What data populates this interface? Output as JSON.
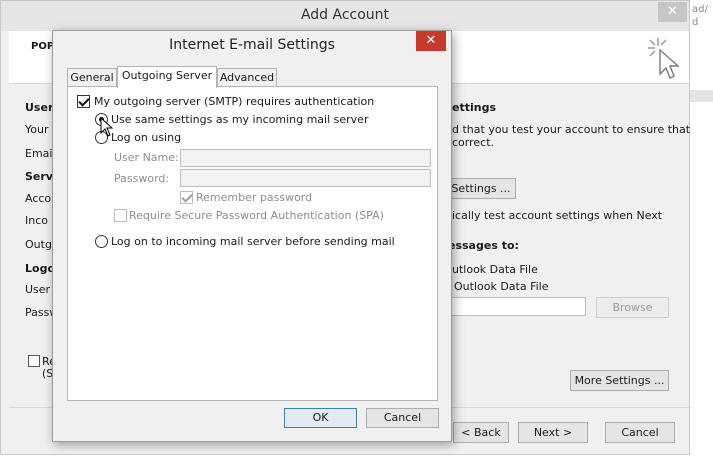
{
  "background": {
    "fragments": [
      "ad/",
      "d"
    ]
  },
  "add_account": {
    "title": "Add Account",
    "header_label": "POP",
    "labels": {
      "user_info_heading": "User",
      "your_name": "Your",
      "email": "Email",
      "server_heading": "Serve",
      "account_type": "Acco",
      "incoming": "Inco",
      "outgoing": "Outg",
      "logon_heading": "Logo",
      "user_name": "User",
      "password": "Passw",
      "remember": "Re",
      "remember_spa": "(S",
      "test_heading": "ettings",
      "test_desc_1": "d that you test your account to ensure that",
      "test_desc_2": "correct.",
      "auto_test_1": "ically test account settings when Next",
      "deliver_heading": "essages to:",
      "new_data_file": "utlook Data File",
      "existing_data_file": "Outlook Data File"
    },
    "buttons": {
      "test_settings": "Settings ...",
      "browse": "Browse",
      "more_settings": "More Settings ...",
      "back": "< Back",
      "next": "Next >",
      "cancel": "Cancel"
    }
  },
  "dialog": {
    "title": "Internet E-mail Settings",
    "tabs": [
      {
        "label": "General",
        "active": false
      },
      {
        "label": "Outgoing Server",
        "active": true
      },
      {
        "label": "Advanced",
        "active": false
      }
    ],
    "smtp_auth_label": "My outgoing server (SMTP) requires authentication",
    "smtp_auth_checked": true,
    "use_same_label": "Use same settings as my incoming mail server",
    "logon_using_label": "Log on using",
    "user_name_label": "User Name:",
    "user_name_value": "",
    "password_label": "Password:",
    "password_value": "",
    "remember_password_label": "Remember password",
    "remember_password_checked": true,
    "spa_label": "Require Secure Password Authentication (SPA)",
    "spa_checked": false,
    "logon_before_label": "Log on to incoming mail server before sending mail",
    "selected_option": "use_same",
    "ok_label": "OK",
    "cancel_label": "Cancel"
  },
  "colors": {
    "close_red": "#c7392b",
    "accent_blue": "#3c7fb1"
  }
}
